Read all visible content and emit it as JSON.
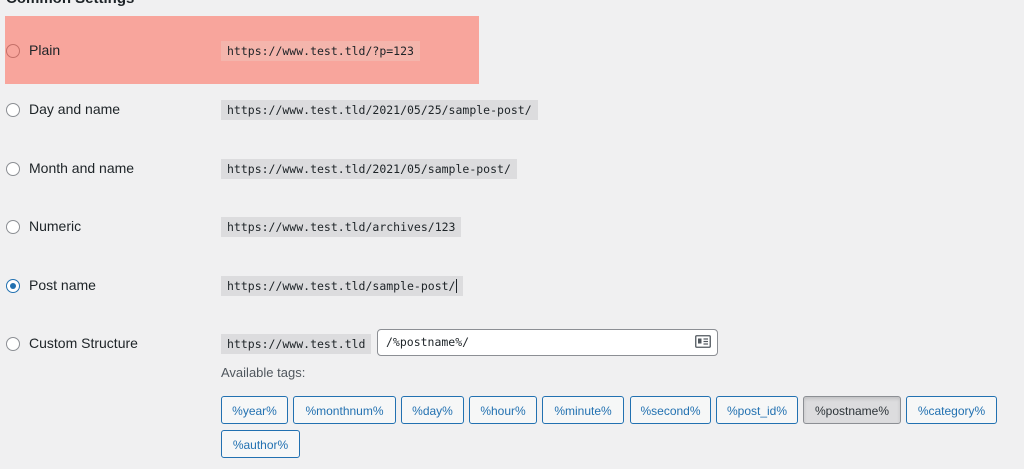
{
  "section": {
    "title": "Common Settings"
  },
  "options": [
    {
      "label": "Plain",
      "code": "https://www.test.tld/?p=123",
      "checked": false
    },
    {
      "label": "Day and name",
      "code": "https://www.test.tld/2021/05/25/sample-post/",
      "checked": false
    },
    {
      "label": "Month and name",
      "code": "https://www.test.tld/2021/05/sample-post/",
      "checked": false
    },
    {
      "label": "Numeric",
      "code": "https://www.test.tld/archives/123",
      "checked": false
    },
    {
      "label": "Post name",
      "code": "https://www.test.tld/sample-post/",
      "checked": true
    },
    {
      "label": "Custom Structure",
      "code": "https://www.test.tld",
      "checked": false
    }
  ],
  "custom": {
    "value": "/%postname%/",
    "input_icon": "id-card-icon",
    "available_tags_label": "Available tags:",
    "tags": [
      "%year%",
      "%monthnum%",
      "%day%",
      "%hour%",
      "%minute%",
      "%second%",
      "%post_id%",
      "%postname%",
      "%category%",
      "%author%"
    ],
    "active_tag": "%postname%"
  },
  "colors": {
    "highlight": "#f8a59c",
    "accent": "#2271b1",
    "code_bg": "#dcdcde",
    "page_bg": "#f0f0f1"
  }
}
